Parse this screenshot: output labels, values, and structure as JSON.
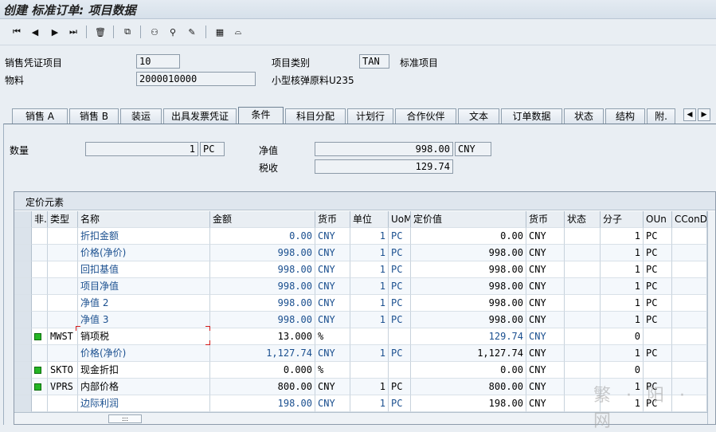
{
  "window": {
    "title": "创建 标准订单: 项目数据"
  },
  "header": {
    "item_label": "销售凭证项目",
    "item_value": "10",
    "category_label": "项目类别",
    "category_value": "TAN",
    "category_text": "标准项目",
    "material_label": "物料",
    "material_value": "2000010000",
    "material_text": "小型核弹原料U235"
  },
  "tabs": [
    {
      "label": "销售 A"
    },
    {
      "label": "销售 B"
    },
    {
      "label": "装运"
    },
    {
      "label": "出具发票凭证"
    },
    {
      "label": "条件"
    },
    {
      "label": "科目分配"
    },
    {
      "label": "计划行"
    },
    {
      "label": "合作伙伴"
    },
    {
      "label": "文本"
    },
    {
      "label": "订单数据"
    },
    {
      "label": "状态"
    },
    {
      "label": "结构"
    },
    {
      "label": "附."
    }
  ],
  "conditions": {
    "qty_label": "数量",
    "qty_value": "1",
    "qty_unit": "PC",
    "net_label": "净值",
    "net_value": "998.00",
    "net_currency": "CNY",
    "tax_label": "税收",
    "tax_value": "129.74"
  },
  "pricing": {
    "title": "定价元素",
    "columns": [
      "非.",
      "类型",
      "名称",
      "金额",
      "货币",
      "单位",
      "UoM",
      "定价值",
      "货币",
      "状态",
      "分子",
      "OUn",
      "CConDe"
    ],
    "rows": [
      {
        "type": "",
        "name": "折扣金额",
        "amount": "0.00",
        "curr": "CNY",
        "unit": "1",
        "uom": "PC",
        "value": "0.00",
        "curr2": "CNY",
        "num": "1",
        "oun": "PC",
        "blue": true,
        "green": false
      },
      {
        "type": "",
        "name": "价格(净价)",
        "amount": "998.00",
        "curr": "CNY",
        "unit": "1",
        "uom": "PC",
        "value": "998.00",
        "curr2": "CNY",
        "num": "1",
        "oun": "PC",
        "blue": true,
        "green": false
      },
      {
        "type": "",
        "name": "回扣基值",
        "amount": "998.00",
        "curr": "CNY",
        "unit": "1",
        "uom": "PC",
        "value": "998.00",
        "curr2": "CNY",
        "num": "1",
        "oun": "PC",
        "blue": true,
        "green": false
      },
      {
        "type": "",
        "name": "项目净值",
        "amount": "998.00",
        "curr": "CNY",
        "unit": "1",
        "uom": "PC",
        "value": "998.00",
        "curr2": "CNY",
        "num": "1",
        "oun": "PC",
        "blue": true,
        "green": false
      },
      {
        "type": "",
        "name": "净值 2",
        "amount": "998.00",
        "curr": "CNY",
        "unit": "1",
        "uom": "PC",
        "value": "998.00",
        "curr2": "CNY",
        "num": "1",
        "oun": "PC",
        "blue": true,
        "green": false
      },
      {
        "type": "",
        "name": "净值 3",
        "amount": "998.00",
        "curr": "CNY",
        "unit": "1",
        "uom": "PC",
        "value": "998.00",
        "curr2": "CNY",
        "num": "1",
        "oun": "PC",
        "blue": true,
        "green": false
      },
      {
        "type": "MWST",
        "name": "销项税",
        "amount": "13.000",
        "curr": "%",
        "unit": "",
        "uom": "",
        "value": "129.74",
        "curr2": "CNY",
        "num": "0",
        "oun": "",
        "blue": false,
        "green": true
      },
      {
        "type": "",
        "name": "价格(净价)",
        "amount": "1,127.74",
        "curr": "CNY",
        "unit": "1",
        "uom": "PC",
        "value": "1,127.74",
        "curr2": "CNY",
        "num": "1",
        "oun": "PC",
        "blue": true,
        "green": false
      },
      {
        "type": "SKTO",
        "name": "现金折扣",
        "amount": "0.000",
        "curr": "%",
        "unit": "",
        "uom": "",
        "value": "0.00",
        "curr2": "CNY",
        "num": "0",
        "oun": "",
        "blue": false,
        "green": true
      },
      {
        "type": "VPRS",
        "name": "内部价格",
        "amount": "800.00",
        "curr": "CNY",
        "unit": "1",
        "uom": "PC",
        "value": "800.00",
        "curr2": "CNY",
        "num": "1",
        "oun": "PC",
        "blue": false,
        "green": true
      },
      {
        "type": "",
        "name": "边际利润",
        "amount": "198.00",
        "curr": "CNY",
        "unit": "1",
        "uom": "PC",
        "value": "198.00",
        "curr2": "CNY",
        "num": "1",
        "oun": "PC",
        "blue": true,
        "green": false
      }
    ]
  },
  "watermark": "繁 · 阳 · 网"
}
